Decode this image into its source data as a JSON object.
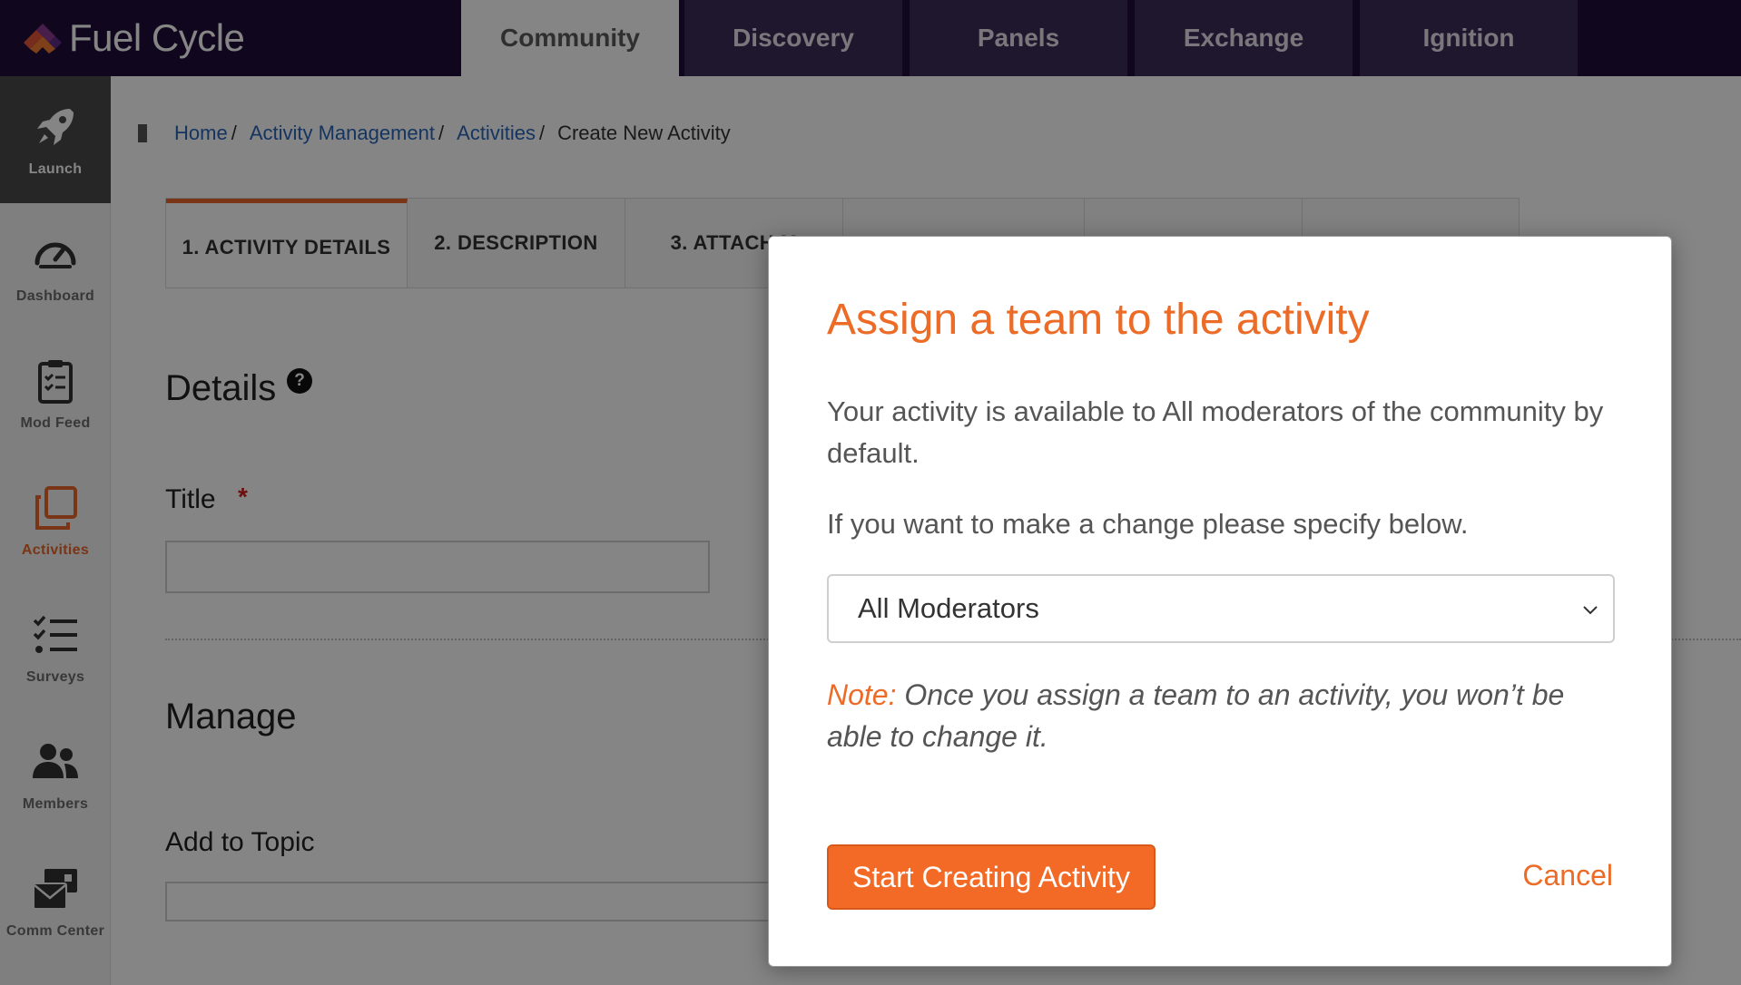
{
  "app": {
    "name": "Fuel Cycle"
  },
  "top_tabs": [
    {
      "label": "Community",
      "active": true
    },
    {
      "label": "Discovery",
      "active": false
    },
    {
      "label": "Panels",
      "active": false
    },
    {
      "label": "Exchange",
      "active": false
    },
    {
      "label": "Ignition",
      "active": false
    }
  ],
  "sidebar": {
    "items": [
      {
        "label": "Launch",
        "icon": "rocket-icon"
      },
      {
        "label": "Dashboard",
        "icon": "speedometer-icon"
      },
      {
        "label": "Mod Feed",
        "icon": "clipboard-icon"
      },
      {
        "label": "Activities",
        "icon": "stacked-squares-icon",
        "active": true
      },
      {
        "label": "Surveys",
        "icon": "checklist-icon"
      },
      {
        "label": "Members",
        "icon": "people-icon"
      },
      {
        "label": "Comm Center",
        "icon": "envelope-icon"
      }
    ]
  },
  "breadcrumb": {
    "items": [
      "Home",
      "Activity Management",
      "Activities"
    ],
    "current": "Create New Activity",
    "separator": "/"
  },
  "steps": [
    {
      "label": "1. ACTIVITY DETAILS",
      "active": true
    },
    {
      "label": "2. DESCRIPTION"
    },
    {
      "label": "3. ATTACH M"
    },
    {
      "label": ""
    },
    {
      "label": ""
    },
    {
      "label": ""
    }
  ],
  "form": {
    "details_heading": "Details",
    "help_symbol": "?",
    "title_label": "Title",
    "required_mark": "*",
    "manage_heading": "Manage",
    "topic_label": "Add to Topic"
  },
  "modal": {
    "title": "Assign a team to the activity",
    "body": "Your activity is available to All moderators of the community by default.",
    "body2": "If you want to make a change please specify below.",
    "select_value": "All Moderators",
    "note_prefix": "Note:",
    "note_text": " Once you assign a team to an activity, you won’t be able to change it.",
    "primary_label": "Start Creating Activity",
    "cancel_label": "Cancel"
  },
  "colors": {
    "accent": "#ec6b26",
    "topbar": "#1f0d38",
    "link": "#2a66b8"
  }
}
